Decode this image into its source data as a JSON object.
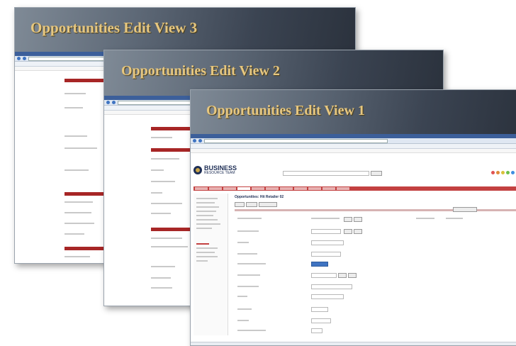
{
  "slides": [
    {
      "title": "Opportunities Edit View 3"
    },
    {
      "title": "Opportunities Edit View 2"
    },
    {
      "title": "Opportunities Edit View 1"
    }
  ],
  "app": {
    "logo_line1": "BUSINESS",
    "logo_line2": "RESOURCE TEAM",
    "page_heading": "Opportunities: Hit Retailer 02"
  },
  "colors": {
    "title_gold": "#e6c780",
    "section_red": "#a72626",
    "nav_red": "#c34141",
    "header_dark": "#2b323d"
  },
  "rating_dots": [
    "#e05252",
    "#e08a3a",
    "#d8c13a",
    "#6cbf4c",
    "#3f8ee0",
    "#8a5ad8",
    "#cfcfcf"
  ]
}
